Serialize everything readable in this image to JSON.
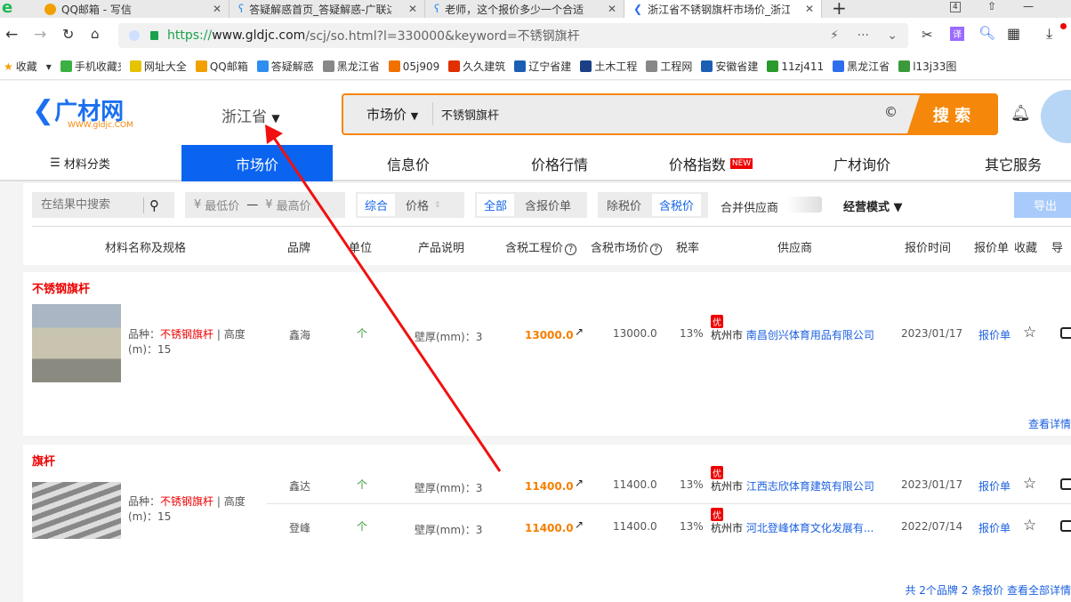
{
  "browser": {
    "tabs": [
      {
        "label": "QQ邮箱 - 写信"
      },
      {
        "label": "答疑解惑首页_答疑解惑-广联达"
      },
      {
        "label": "老师，这个报价多少一个合适"
      },
      {
        "label": "浙江省不锈钢旗杆市场价_浙江"
      }
    ],
    "new_tab": "+",
    "tab_count": "4",
    "url_scheme": "https://",
    "url_host": "www.gldjc.com",
    "url_path": "/scj/so.html?l=330000&keyword=不锈钢旗杆",
    "bookmarks": [
      {
        "label": "收藏",
        "icon": "star-icon",
        "color": "#f5a000"
      },
      {
        "label": "手机收藏夹",
        "icon": "phone-icon",
        "color": "#3cb043"
      },
      {
        "label": "网址大全",
        "icon": "plus-circle-icon",
        "color": "#e6c300"
      },
      {
        "label": "QQ邮箱",
        "icon": "qq-mail-icon",
        "color": "#f0a000"
      },
      {
        "label": "答疑解惑",
        "icon": "glodon-icon",
        "color": "#2d8ef0"
      },
      {
        "label": "黑龙江省",
        "icon": "globe-icon",
        "color": "#888888"
      },
      {
        "label": "05j909",
        "icon": "doc-icon",
        "color": "#f07000"
      },
      {
        "label": "久久建筑",
        "icon": "jiujiu-icon",
        "color": "#e03000"
      },
      {
        "label": "辽宁省建",
        "icon": "site-icon",
        "color": "#1a5fb4"
      },
      {
        "label": "土木工程",
        "icon": "site-icon",
        "color": "#1a3f84"
      },
      {
        "label": "工程网",
        "icon": "globe-icon",
        "color": "#888888"
      },
      {
        "label": "安徽省建",
        "icon": "site-icon",
        "color": "#1a5fb4"
      },
      {
        "label": "11zj411",
        "icon": "leaf-icon",
        "color": "#2a9a2a"
      },
      {
        "label": "黑龙江省",
        "icon": "gldjc-icon",
        "color": "#2d6ef0"
      },
      {
        "label": "l13j33图",
        "icon": "doc-icon",
        "color": "#3a9a3a"
      }
    ]
  },
  "header": {
    "logo_text": "广材网",
    "logo_sub": "WWW.gldjc.COM",
    "region": "浙江省",
    "search_type": "市场价",
    "search_value": "不锈钢旗杆",
    "search_button": "搜 索",
    "accent": "#f5870a"
  },
  "nav": {
    "category": "材料分类",
    "items": [
      {
        "label": "市场价",
        "active": true
      },
      {
        "label": "信息价"
      },
      {
        "label": "价格行情"
      },
      {
        "label": "价格指数",
        "badge": "NEW"
      },
      {
        "label": "广材询价"
      },
      {
        "label": "其它服务"
      }
    ],
    "active_color": "#0a64f0"
  },
  "filter": {
    "search_placeholder": "在结果中搜索",
    "min_placeholder": "最低价",
    "max_placeholder": "最高价",
    "currency": "¥",
    "dash": "—",
    "sort": [
      "综合",
      "价格"
    ],
    "scope": [
      "全部",
      "含报价单"
    ],
    "tax": [
      "除税价",
      "含税价"
    ],
    "merge": "合并供应商",
    "mode": "经营模式",
    "export": "导出"
  },
  "columns": [
    "材料名称及规格",
    "品牌",
    "单位",
    "产品说明",
    "含税工程价",
    "含税市场价",
    "税率",
    "供应商",
    "报价时间",
    "报价单",
    "收藏",
    "导"
  ],
  "groups": [
    {
      "title": "不锈钢旗杆",
      "spec_label": "品种：",
      "spec_value": "不锈钢旗杆",
      "spec_rest": "| 高度(m)：15",
      "footer": "查看详情",
      "rows": [
        {
          "brand": "鑫海",
          "unit": "个",
          "desc": "壁厚(mm)：3",
          "eng_price": "13000.0",
          "market_price": "13000.0",
          "tax": "13%",
          "badge": "优",
          "city": "杭州市",
          "supplier": "南昌创兴体育用品有限公司",
          "date": "2023/01/17",
          "quote": "报价单"
        }
      ]
    },
    {
      "title": "旗杆",
      "spec_label": "品种：",
      "spec_value": "不锈钢旗杆",
      "spec_rest": "| 高度(m)：15",
      "footer": "共 2个品牌 2 条报价 查看全部详情",
      "rows": [
        {
          "brand": "鑫达",
          "unit": "个",
          "desc": "壁厚(mm)：3",
          "eng_price": "11400.0",
          "market_price": "11400.0",
          "tax": "13%",
          "badge": "优",
          "city": "杭州市",
          "supplier": "江西志欣体育建筑有限公司",
          "date": "2023/01/17",
          "quote": "报价单"
        },
        {
          "brand": "登峰",
          "unit": "个",
          "desc": "壁厚(mm)：3",
          "eng_price": "11400.0",
          "market_price": "11400.0",
          "tax": "13%",
          "badge": "优",
          "city": "杭州市",
          "supplier": "河北登峰体育文化发展有...",
          "date": "2022/07/14",
          "quote": "报价单"
        }
      ]
    }
  ]
}
